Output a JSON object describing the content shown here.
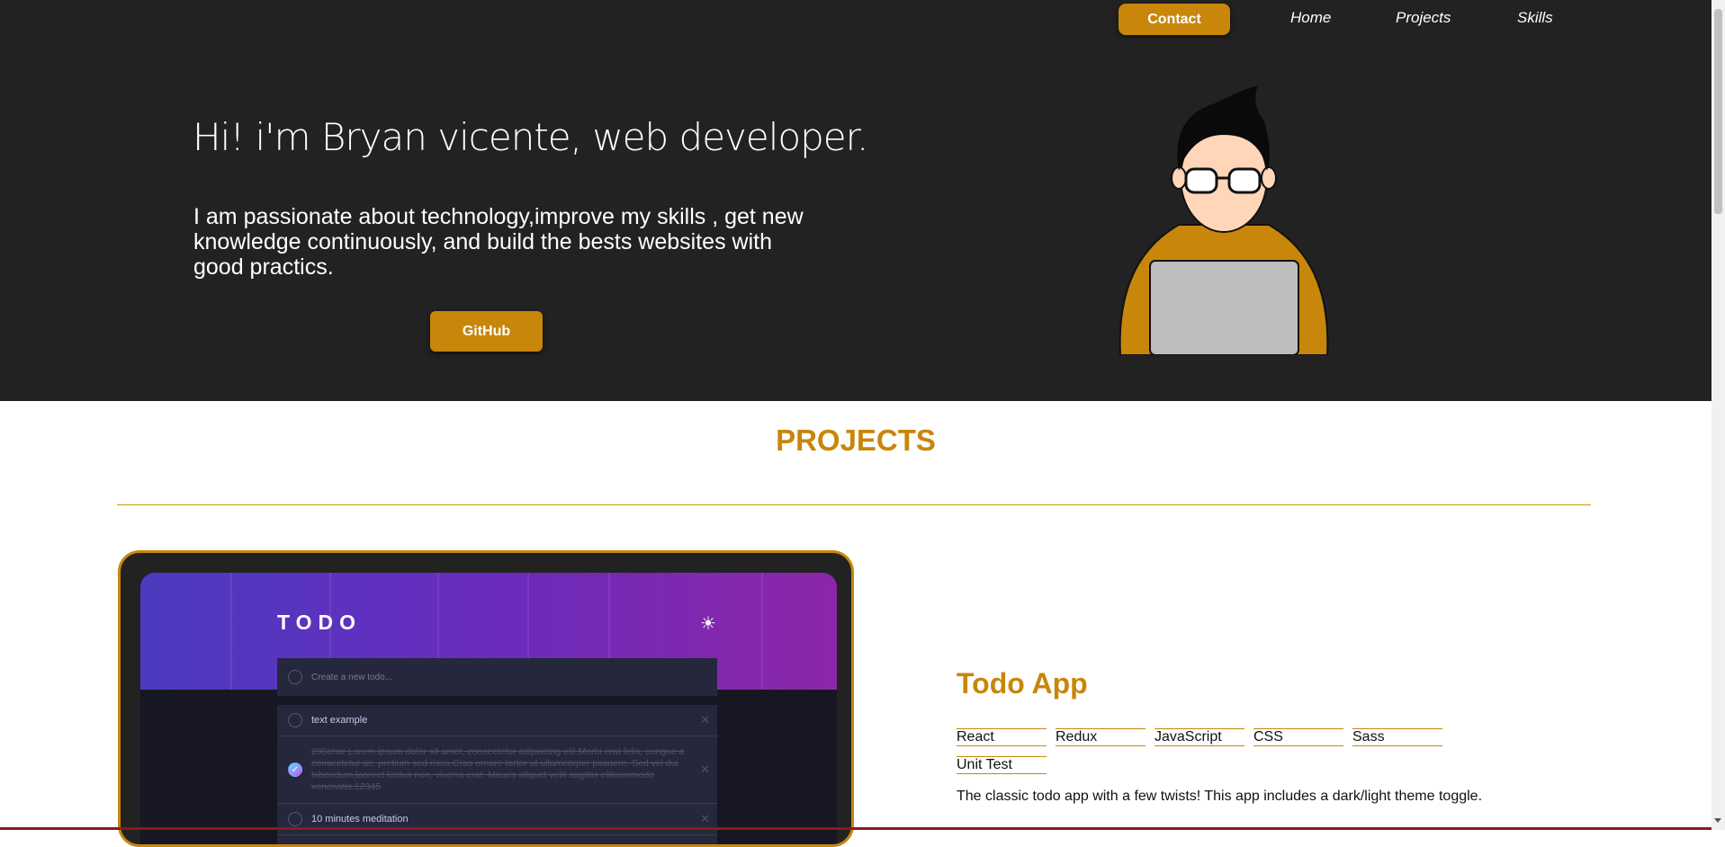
{
  "nav": {
    "contact": "Contact",
    "home": "Home",
    "projects": "Projects",
    "skills": "Skills"
  },
  "hero": {
    "title": "Hi! i'm Bryan vicente, web developer.",
    "text": "I am passionate about technology,improve my skills , get new knowledge continuously, and build the bests websites with good practics.",
    "github_label": "GitHub"
  },
  "projects": {
    "heading": "PROJECTS",
    "items": [
      {
        "title": "Todo App",
        "tags": [
          "React",
          "Redux",
          "JavaScript",
          "CSS",
          "Sass",
          "Unit Test"
        ],
        "description": "The classic todo app with a few twists! This app includes a dark/light theme toggle.",
        "preview": {
          "logo": "TODO",
          "input_placeholder": "Create a new todo...",
          "todos": [
            {
              "text": "text example",
              "done": false
            },
            {
              "text": "280char Lorem ipsum dolor sit amet, consectetur adipiscing elit.Morbi erat felis, congue a consectetur ac, pretium sed risus.Cras ornare tortor ut ullamcorper posuere. Sed vel dui bibendum,laoreet lectus non, viverra erat. Mauris aliquet velit sagittis elitcommodo venenatis.12345",
              "done": true
            },
            {
              "text": "10 minutes meditation",
              "done": false
            }
          ]
        }
      }
    ]
  },
  "colors": {
    "accent": "#c8860a",
    "hero_bg": "#222222"
  }
}
